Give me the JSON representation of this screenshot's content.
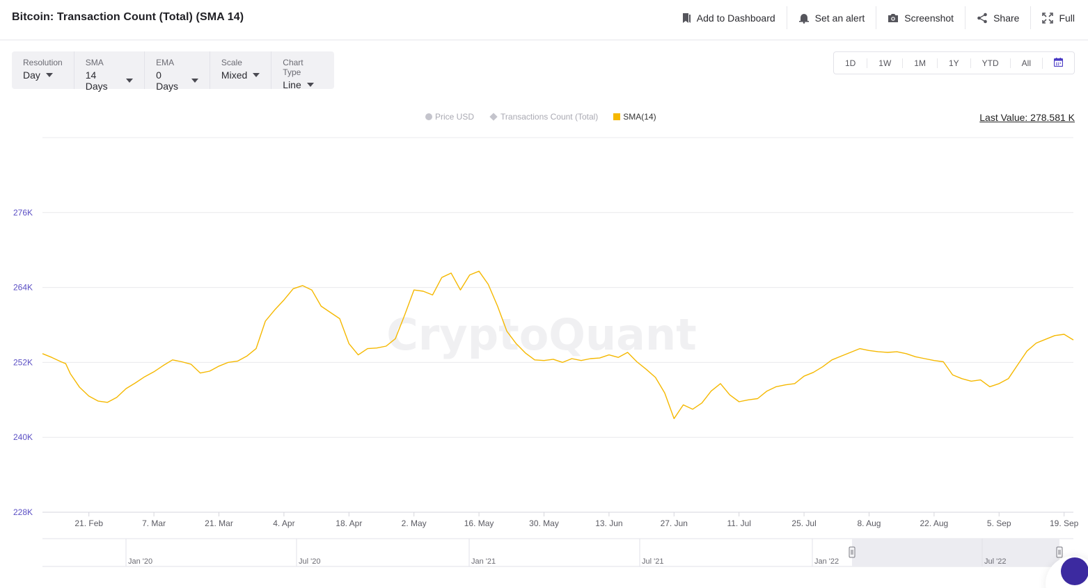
{
  "header": {
    "title": "Bitcoin: Transaction Count (Total) (SMA 14)",
    "actions": [
      {
        "label": "Add to Dashboard",
        "icon": "bookmark-icon"
      },
      {
        "label": "Set an alert",
        "icon": "bell-icon"
      },
      {
        "label": "Screenshot",
        "icon": "camera-icon"
      },
      {
        "label": "Share",
        "icon": "share-icon"
      },
      {
        "label": "Full",
        "icon": "fullscreen-icon"
      }
    ]
  },
  "controls": [
    {
      "label": "Resolution",
      "value": "Day"
    },
    {
      "label": "SMA",
      "value": "14 Days"
    },
    {
      "label": "EMA",
      "value": "0 Days"
    },
    {
      "label": "Scale",
      "value": "Mixed"
    },
    {
      "label": "Chart Type",
      "value": "Line"
    }
  ],
  "ranges": [
    "1D",
    "1W",
    "1M",
    "1Y",
    "YTD",
    "All"
  ],
  "last_value": "Last Value: 278.581 K",
  "watermark": "CryptoQuant",
  "colors": {
    "accent": "#f5b800",
    "axis_label": "#5b4fc4",
    "grid": "#e8e8ec",
    "inactive": "#c4c4cc"
  },
  "chart_data": {
    "type": "line",
    "title": "Bitcoin: Transaction Count (Total) (SMA 14)",
    "xlabel": "",
    "ylabel": "",
    "legend": [
      {
        "name": "Price USD",
        "active": false,
        "marker": "circle"
      },
      {
        "name": "Transactions Count (Total)",
        "active": false,
        "marker": "diamond"
      },
      {
        "name": "SMA(14)",
        "active": true,
        "marker": "square"
      }
    ],
    "y_ticks": [
      {
        "value": 228000,
        "label": "228K"
      },
      {
        "value": 240000,
        "label": "240K"
      },
      {
        "value": 252000,
        "label": "252K"
      },
      {
        "value": 264000,
        "label": "264K"
      },
      {
        "value": 276000,
        "label": "276K"
      }
    ],
    "ylim": [
      228000,
      288000
    ],
    "x_range": [
      "2022-02-11",
      "2022-09-21"
    ],
    "x_ticks": [
      {
        "date": "2022-02-21",
        "label": "21. Feb"
      },
      {
        "date": "2022-03-07",
        "label": "7. Mar"
      },
      {
        "date": "2022-03-21",
        "label": "21. Mar"
      },
      {
        "date": "2022-04-04",
        "label": "4. Apr"
      },
      {
        "date": "2022-04-18",
        "label": "18. Apr"
      },
      {
        "date": "2022-05-02",
        "label": "2. May"
      },
      {
        "date": "2022-05-16",
        "label": "16. May"
      },
      {
        "date": "2022-05-30",
        "label": "30. May"
      },
      {
        "date": "2022-06-13",
        "label": "13. Jun"
      },
      {
        "date": "2022-06-27",
        "label": "27. Jun"
      },
      {
        "date": "2022-07-11",
        "label": "11. Jul"
      },
      {
        "date": "2022-07-25",
        "label": "25. Jul"
      },
      {
        "date": "2022-08-08",
        "label": "8. Aug"
      },
      {
        "date": "2022-08-22",
        "label": "22. Aug"
      },
      {
        "date": "2022-09-05",
        "label": "5. Sep"
      },
      {
        "date": "2022-09-19",
        "label": "19. Sep"
      }
    ],
    "series": [
      {
        "name": "SMA(14)",
        "color": "#f5b800",
        "points": [
          [
            "2022-02-11",
            253400
          ],
          [
            "2022-02-13",
            252800
          ],
          [
            "2022-02-15",
            252100
          ],
          [
            "2022-02-16",
            251800
          ],
          [
            "2022-02-17",
            250200
          ],
          [
            "2022-02-19",
            248000
          ],
          [
            "2022-02-21",
            246600
          ],
          [
            "2022-02-23",
            245800
          ],
          [
            "2022-02-25",
            245600
          ],
          [
            "2022-02-27",
            246400
          ],
          [
            "2022-03-01",
            247800
          ],
          [
            "2022-03-03",
            248700
          ],
          [
            "2022-03-05",
            249700
          ],
          [
            "2022-03-07",
            250500
          ],
          [
            "2022-03-09",
            251500
          ],
          [
            "2022-03-11",
            252400
          ],
          [
            "2022-03-13",
            252100
          ],
          [
            "2022-03-15",
            251700
          ],
          [
            "2022-03-17",
            250300
          ],
          [
            "2022-03-19",
            250600
          ],
          [
            "2022-03-21",
            251400
          ],
          [
            "2022-03-23",
            252000
          ],
          [
            "2022-03-25",
            252200
          ],
          [
            "2022-03-27",
            253000
          ],
          [
            "2022-03-29",
            254200
          ],
          [
            "2022-03-31",
            258600
          ],
          [
            "2022-04-02",
            260400
          ],
          [
            "2022-04-04",
            262000
          ],
          [
            "2022-04-06",
            263800
          ],
          [
            "2022-04-08",
            264300
          ],
          [
            "2022-04-10",
            263600
          ],
          [
            "2022-04-12",
            261000
          ],
          [
            "2022-04-14",
            260000
          ],
          [
            "2022-04-16",
            259000
          ],
          [
            "2022-04-18",
            255000
          ],
          [
            "2022-04-20",
            253200
          ],
          [
            "2022-04-22",
            254200
          ],
          [
            "2022-04-24",
            254300
          ],
          [
            "2022-04-26",
            254600
          ],
          [
            "2022-04-28",
            255800
          ],
          [
            "2022-04-30",
            259600
          ],
          [
            "2022-05-02",
            263600
          ],
          [
            "2022-05-04",
            263400
          ],
          [
            "2022-05-06",
            262800
          ],
          [
            "2022-05-08",
            265600
          ],
          [
            "2022-05-10",
            266300
          ],
          [
            "2022-05-12",
            263600
          ],
          [
            "2022-05-14",
            266000
          ],
          [
            "2022-05-16",
            266600
          ],
          [
            "2022-05-18",
            264500
          ],
          [
            "2022-05-20",
            261000
          ],
          [
            "2022-05-22",
            257000
          ],
          [
            "2022-05-24",
            255000
          ],
          [
            "2022-05-26",
            253500
          ],
          [
            "2022-05-28",
            252400
          ],
          [
            "2022-05-30",
            252300
          ],
          [
            "2022-06-01",
            252500
          ],
          [
            "2022-06-03",
            252000
          ],
          [
            "2022-06-05",
            252600
          ],
          [
            "2022-06-07",
            252300
          ],
          [
            "2022-06-09",
            252600
          ],
          [
            "2022-06-11",
            252700
          ],
          [
            "2022-06-13",
            253200
          ],
          [
            "2022-06-15",
            252800
          ],
          [
            "2022-06-17",
            253600
          ],
          [
            "2022-06-19",
            252100
          ],
          [
            "2022-06-21",
            250900
          ],
          [
            "2022-06-23",
            249600
          ],
          [
            "2022-06-25",
            247100
          ],
          [
            "2022-06-27",
            243000
          ],
          [
            "2022-06-29",
            245200
          ],
          [
            "2022-07-01",
            244500
          ],
          [
            "2022-07-03",
            245500
          ],
          [
            "2022-07-05",
            247400
          ],
          [
            "2022-07-07",
            248600
          ],
          [
            "2022-07-09",
            246800
          ],
          [
            "2022-07-11",
            245700
          ],
          [
            "2022-07-13",
            246000
          ],
          [
            "2022-07-15",
            246200
          ],
          [
            "2022-07-17",
            247400
          ],
          [
            "2022-07-19",
            248100
          ],
          [
            "2022-07-21",
            248400
          ],
          [
            "2022-07-23",
            248600
          ],
          [
            "2022-07-25",
            249800
          ],
          [
            "2022-07-27",
            250400
          ],
          [
            "2022-07-29",
            251300
          ],
          [
            "2022-07-31",
            252400
          ],
          [
            "2022-08-02",
            253000
          ],
          [
            "2022-08-04",
            253600
          ],
          [
            "2022-08-06",
            254200
          ],
          [
            "2022-08-08",
            253900
          ],
          [
            "2022-08-10",
            253700
          ],
          [
            "2022-08-12",
            253600
          ],
          [
            "2022-08-14",
            253700
          ],
          [
            "2022-08-16",
            253400
          ],
          [
            "2022-08-18",
            252900
          ],
          [
            "2022-08-20",
            252600
          ],
          [
            "2022-08-22",
            252300
          ],
          [
            "2022-08-24",
            252100
          ],
          [
            "2022-08-26",
            250000
          ],
          [
            "2022-08-28",
            249400
          ],
          [
            "2022-08-30",
            249000
          ],
          [
            "2022-09-01",
            249200
          ],
          [
            "2022-09-03",
            248100
          ],
          [
            "2022-09-05",
            248600
          ],
          [
            "2022-09-07",
            249400
          ],
          [
            "2022-09-09",
            251600
          ],
          [
            "2022-09-11",
            253800
          ],
          [
            "2022-09-13",
            255100
          ],
          [
            "2022-09-15",
            255700
          ],
          [
            "2022-09-17",
            256300
          ],
          [
            "2022-09-19",
            256500
          ],
          [
            "2022-09-21",
            255600
          ]
        ]
      }
    ],
    "navigator": {
      "labels": [
        "Jan '20",
        "Jul '20",
        "Jan '21",
        "Jul '21",
        "Jan '22",
        "Jul '22"
      ]
    }
  }
}
